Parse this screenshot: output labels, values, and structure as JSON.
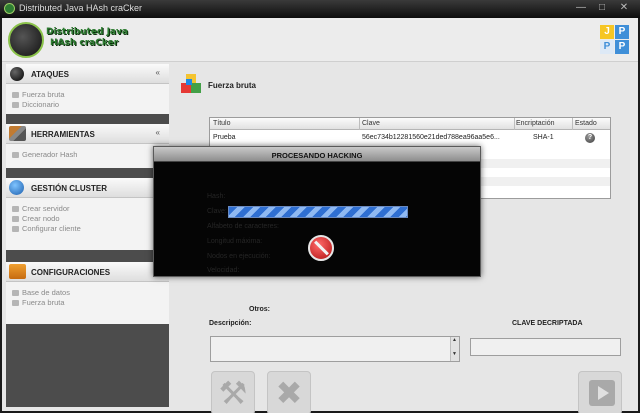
{
  "window": {
    "title": "Distributed Java HAsh craCker",
    "controls": {
      "minimize": "—",
      "maximize": "□",
      "close": "✕"
    }
  },
  "header": {
    "logo_line1": "Distributed Java",
    "logo_line2": "HAsh craCker",
    "badge": [
      "J",
      "P",
      "P",
      "P"
    ]
  },
  "sidebar": {
    "sections": [
      {
        "title": "ATAQUES",
        "icon": "bomb-icon",
        "items": [
          "Fuerza bruta",
          "Diccionario"
        ]
      },
      {
        "title": "HERRAMIENTAS",
        "icon": "tools-icon",
        "items": [
          "Generador Hash"
        ]
      },
      {
        "title": "GESTIÓN CLUSTER",
        "icon": "globe-icon",
        "items": [
          "Crear servidor",
          "Crear nodo",
          "Configurar cliente"
        ]
      },
      {
        "title": "CONFIGURACIONES",
        "icon": "settings-icon",
        "items": [
          "Base de datos",
          "Fuerza bruta"
        ]
      }
    ],
    "collapse_glyph": "«"
  },
  "main": {
    "title": "Fuerza bruta",
    "table": {
      "columns": [
        "Título",
        "Clave",
        "Encriptación",
        "Estado"
      ],
      "rows": [
        {
          "titulo": "Prueba",
          "clave": "56ec734b12281560e21ded788ea96aa5e6...",
          "encriptacion": "SHA-1",
          "estado_icon": "?"
        }
      ]
    },
    "otros_label": "Otros:",
    "descripcion_label": "Descripción:",
    "clave_label": "CLAVE DECRIPTADA",
    "description_value": "",
    "key_value": ""
  },
  "dialog": {
    "title": "PROCESANDO HACKING",
    "labels": [
      "Hash:",
      "Clave:",
      "Alfabeto de caracteres:",
      "Longitud máxima:",
      "Nodos en ejecución:",
      "Velocidad:"
    ],
    "progress": 1.0,
    "icon": "stop-icon"
  },
  "colors": {
    "accent": "#2e7d32",
    "progress": "#2f6fd2",
    "dialog_bg": "#050505"
  }
}
